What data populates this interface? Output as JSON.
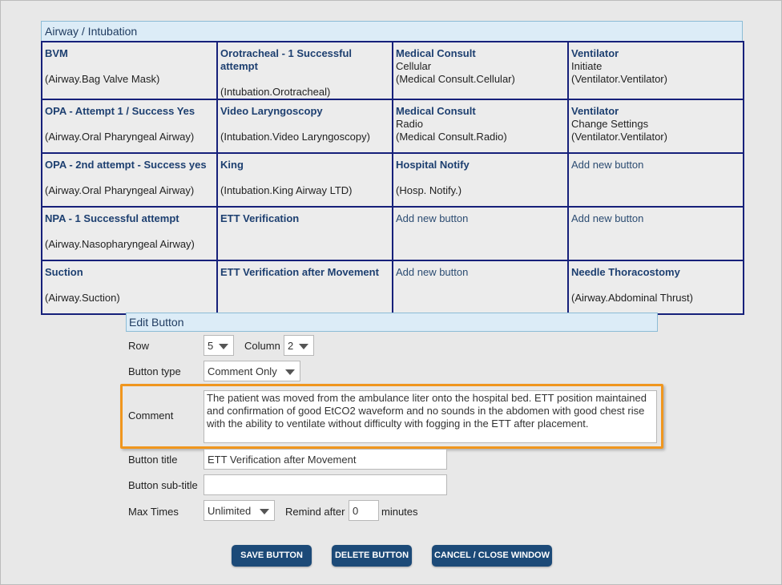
{
  "grid": {
    "title": "Airway / Intubation",
    "rows": [
      [
        {
          "title": "BVM",
          "line2": "",
          "sub": "(Airway.Bag Valve Mask)"
        },
        {
          "title": "Orotracheal - 1 Successful attempt",
          "line2": "",
          "sub": "(Intubation.Orotracheal)"
        },
        {
          "title": "Medical Consult",
          "line2": "Cellular",
          "sub": "(Medical Consult.Cellular)"
        },
        {
          "title": "Ventilator",
          "line2": "Initiate",
          "sub": "(Ventilator.Ventilator)"
        }
      ],
      [
        {
          "title": "OPA - Attempt 1 / Success Yes",
          "line2": "",
          "sub": "(Airway.Oral Pharyngeal Airway)"
        },
        {
          "title": "Video Laryngoscopy",
          "line2": "",
          "sub": "(Intubation.Video Laryngoscopy)"
        },
        {
          "title": "Medical Consult",
          "line2": "Radio",
          "sub": "(Medical Consult.Radio)"
        },
        {
          "title": "Ventilator",
          "line2": "Change Settings",
          "sub": "(Ventilator.Ventilator)"
        }
      ],
      [
        {
          "title": "OPA - 2nd attempt - Success yes",
          "line2": "",
          "sub": "(Airway.Oral Pharyngeal Airway)"
        },
        {
          "title": "King",
          "line2": "",
          "sub": "(Intubation.King Airway LTD)"
        },
        {
          "title": "Hospital Notify",
          "line2": "",
          "sub": "(Hosp. Notify.)"
        },
        {
          "add": "Add new button"
        }
      ],
      [
        {
          "title": "NPA - 1 Successful attempt",
          "line2": "",
          "sub": "(Airway.Nasopharyngeal Airway)"
        },
        {
          "title": "ETT Verification",
          "line2": "",
          "sub": ""
        },
        {
          "add": "Add new button"
        },
        {
          "add": "Add new button"
        }
      ],
      [
        {
          "title": "Suction",
          "line2": "",
          "sub": "(Airway.Suction)"
        },
        {
          "title": "ETT Verification after Movement",
          "line2": "",
          "sub": ""
        },
        {
          "add": "Add new button"
        },
        {
          "title": "Needle Thoracostomy",
          "line2": "",
          "sub": "(Airway.Abdominal Thrust)"
        }
      ]
    ]
  },
  "edit": {
    "title": "Edit Button",
    "row_label": "Row",
    "row_value": "5",
    "column_label": "Column",
    "column_value": "2",
    "type_label": "Button type",
    "type_value": "Comment Only",
    "comment_label": "Comment",
    "comment_value": "The patient was moved from the ambulance liter onto the hospital bed.  ETT position maintained and confirmation of good EtCO2 waveform and no sounds in the abdomen with good chest rise with the ability to ventilate without difficulty with fogging in the ETT after placement.",
    "title_label": "Button title",
    "title_value": "ETT Verification after Movement",
    "subtitle_label": "Button sub-title",
    "subtitle_value": "",
    "max_label": "Max Times",
    "max_value": "Unlimited",
    "remind_label": "Remind after",
    "remind_value": "0",
    "minutes_label": "minutes"
  },
  "buttons": {
    "save": "SAVE BUTTON",
    "delete": "DELETE BUTTON",
    "cancel": "CANCEL / CLOSE WINDOW"
  },
  "colors": {
    "accent": "#1c4a78",
    "highlight": "#f0961e",
    "grid_border": "#16207a",
    "header_bg": "#dcecf7"
  }
}
